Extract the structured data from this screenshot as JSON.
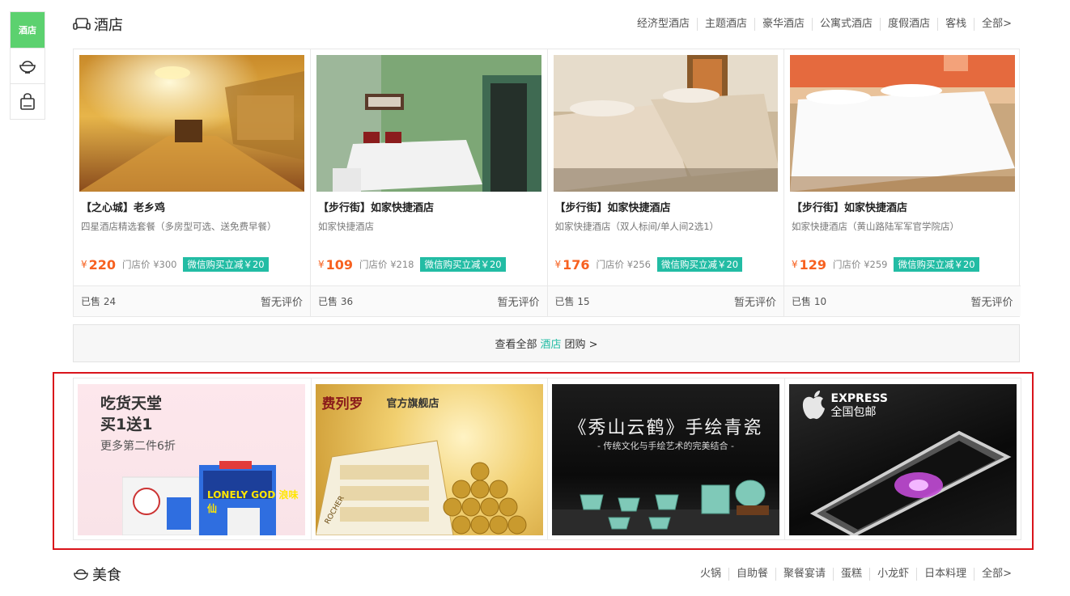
{
  "side_nav": {
    "items": [
      {
        "label": "酒店",
        "icon": "hotel-text"
      },
      {
        "icon": "bowl-icon"
      },
      {
        "icon": "shopping-bag-icon"
      }
    ]
  },
  "hotel_section": {
    "title": "酒店",
    "icon": "sofa-icon",
    "tags": [
      "经济型酒店",
      "主题酒店",
      "豪华酒店",
      "公寓式酒店",
      "度假酒店",
      "客栈",
      "全部>"
    ],
    "deals": [
      {
        "name": "【之心城】老乡鸡",
        "desc": "四星酒店精选套餐（多房型可选、送免费早餐）",
        "currency": "¥",
        "price": "220",
        "orig": "门店价 ¥300",
        "promo": "微信购买立减￥20",
        "sold": "已售 24",
        "rating": "暂无评价"
      },
      {
        "name": "【步行街】如家快捷酒店",
        "desc": "如家快捷酒店",
        "currency": "¥",
        "price": "109",
        "orig": "门店价 ¥218",
        "promo": "微信购买立减￥20",
        "sold": "已售 36",
        "rating": "暂无评价"
      },
      {
        "name": "【步行街】如家快捷酒店",
        "desc": "如家快捷酒店（双人标间/单人间2选1）",
        "currency": "¥",
        "price": "176",
        "orig": "门店价 ¥256",
        "promo": "微信购买立减￥20",
        "sold": "已售 15",
        "rating": "暂无评价"
      },
      {
        "name": "【步行街】如家快捷酒店",
        "desc": "如家快捷酒店（黄山路陆军军官学院店）",
        "currency": "¥",
        "price": "129",
        "orig": "门店价 ¥259",
        "promo": "微信购买立减￥20",
        "sold": "已售 10",
        "rating": "暂无评价"
      }
    ],
    "view_all": {
      "prefix": "查看全部",
      "highlight": "酒店",
      "suffix": "团购 >"
    }
  },
  "ads": [
    {
      "line1": "吃货天堂",
      "line2": "买1送1",
      "line3": "更多第二件6折",
      "product_text": "LONELY GOD 浪味仙"
    },
    {
      "brand": "费列罗",
      "store": "官方旗舰店",
      "box_text": "ROCHER"
    },
    {
      "title": "《秀山云鹤》手绘青瓷",
      "subtitle": "- 传统文化与手绘艺术的完美结合 -"
    },
    {
      "express": "EXPRESS",
      "shipping": "全国包邮"
    }
  ],
  "food_section": {
    "title": "美食",
    "icon": "bowl-icon",
    "tags": [
      "火锅",
      "自助餐",
      "聚餐宴请",
      "蛋糕",
      "小龙虾",
      "日本料理",
      "全部>"
    ]
  },
  "colors": {
    "accent_green": "#5cd16f",
    "promo_teal": "#22bca4",
    "price_orange": "#f76120",
    "highlight_red": "#d9141b"
  }
}
